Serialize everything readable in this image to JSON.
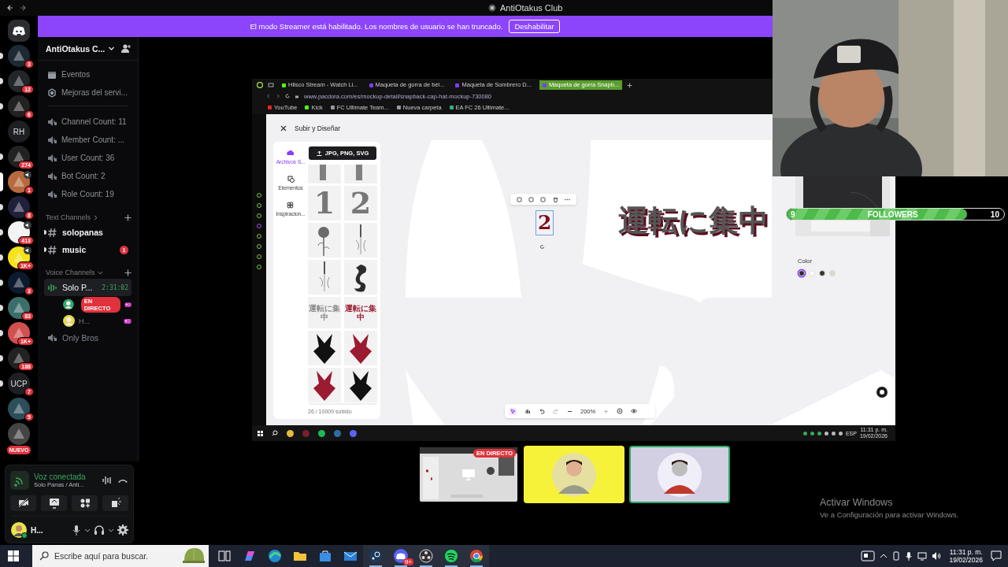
{
  "title_bar": {
    "title": "AntiOtakus Club"
  },
  "streamer_banner": {
    "message": "El modo Streamer está habilitado. Los nombres de usuario se han truncado.",
    "button": "Deshabilitar"
  },
  "servers": [
    {
      "kind": "home",
      "unread": false,
      "selected": false,
      "voice": false
    },
    {
      "kind": "icon",
      "badge": "3",
      "unread": true,
      "selected": false,
      "voice": false
    },
    {
      "kind": "icon",
      "badge": "12",
      "unread": true,
      "selected": false,
      "voice": false
    },
    {
      "kind": "icon",
      "badge": "6",
      "unread": true,
      "selected": false,
      "voice": false
    },
    {
      "kind": "text",
      "label": "RH",
      "unread": false,
      "selected": false,
      "voice": false
    },
    {
      "kind": "icon",
      "badge": "274",
      "unread": true,
      "selected": false,
      "voice": false
    },
    {
      "kind": "icon",
      "badge": "1",
      "unread": false,
      "selected": true,
      "voice": true
    },
    {
      "kind": "icon",
      "badge": "8",
      "unread": true,
      "selected": false,
      "voice": false
    },
    {
      "kind": "icon",
      "badge": "413",
      "unread": true,
      "selected": false,
      "voice": true
    },
    {
      "kind": "icon",
      "badge": "1K+",
      "unread": true,
      "selected": false,
      "voice": true
    },
    {
      "kind": "icon",
      "badge": "3",
      "unread": true,
      "selected": false,
      "voice": false
    },
    {
      "kind": "icon",
      "badge": "83",
      "unread": true,
      "selected": false,
      "voice": false
    },
    {
      "kind": "icon",
      "badge": "1K+",
      "unread": true,
      "selected": false,
      "voice": false
    },
    {
      "kind": "icon",
      "badge": "188",
      "unread": true,
      "selected": false,
      "voice": false
    },
    {
      "kind": "text",
      "label": "UCP",
      "badge": "7",
      "unread": true,
      "selected": false,
      "voice": false
    },
    {
      "kind": "icon",
      "badge": "5",
      "unread": false,
      "selected": false,
      "voice": false
    },
    {
      "kind": "icon",
      "pill": "NUEVO",
      "unread": false,
      "selected": false,
      "voice": false
    }
  ],
  "server_header": {
    "name": "AntiOtakus C..."
  },
  "sidebar": {
    "items": [
      {
        "kind": "events",
        "label": "Eventos"
      },
      {
        "kind": "boosts",
        "label": "Mejoras del servi..."
      }
    ],
    "stat_channels": [
      {
        "label": "Channel Count: 11"
      },
      {
        "label": "Member Count: ..."
      },
      {
        "label": "User Count: 36"
      },
      {
        "label": "Bot Count: 2"
      },
      {
        "label": "Role Count: 19"
      }
    ],
    "categories": [
      {
        "name": "Text Channels",
        "expanded": false,
        "channels": [
          {
            "kind": "text",
            "name": "solopanas",
            "unread": true,
            "selected": false
          },
          {
            "kind": "text",
            "name": "music",
            "unread": true,
            "selected": false,
            "badge": "1"
          }
        ]
      },
      {
        "name": "Voice Channels",
        "expanded": true,
        "channels": [
          {
            "kind": "voice",
            "name": "Solo P...",
            "unread": true,
            "selected": true,
            "time": "2:31:02",
            "users": [
              {
                "badge": "EN DIRECTO",
                "activity": true
              },
              {
                "name": "H...",
                "activity": true
              }
            ]
          },
          {
            "kind": "voice",
            "name": "Only Bros",
            "unread": false,
            "selected": false
          }
        ]
      }
    ]
  },
  "voice_panel": {
    "status": "Voz conectada",
    "channel": "Solo Panas / Anti...",
    "user": {
      "name": "H..."
    }
  },
  "stream": {
    "browser": {
      "tabs": [
        {
          "title": "Hilsco Stream - Watch Li...",
          "selected": false
        },
        {
          "title": "Maqueta de gorra de béi...",
          "selected": false
        },
        {
          "title": "Maqueta de Sombrero D...",
          "selected": false
        },
        {
          "title": "Maqueta de gorra Snapb...",
          "selected": true
        }
      ],
      "url": "www.pacdora.com/es/mockup-detail/snapback-cap-hat-mockup-730080",
      "bookmarks": [
        "YouTube",
        "Kick",
        "FC Ultimate Team...",
        "Nueva carpeta",
        "EA FC 26 Ultimate..."
      ]
    },
    "page": {
      "title": "Subir y Diseñar",
      "nav": [
        {
          "label": "Archivos S...",
          "selected": true
        },
        {
          "label": "Elementos",
          "selected": false
        },
        {
          "label": "Inspiracion...",
          "selected": false
        }
      ],
      "upload_button": "JPG, PNG, SVG",
      "assets": [
        {
          "kind": "partial"
        },
        {
          "kind": "partial"
        },
        {
          "kind": "glyph",
          "text": "1"
        },
        {
          "kind": "glyph",
          "text": "2"
        },
        {
          "kind": "rose"
        },
        {
          "kind": "sword"
        },
        {
          "kind": "sword"
        },
        {
          "kind": "dragon"
        },
        {
          "kind": "phrase",
          "text": "運転に集中",
          "color": "#8a8a8a"
        },
        {
          "kind": "phrase",
          "text": "運転に集中",
          "color": "#9b1b30"
        },
        {
          "kind": "tribal",
          "color": "#111111"
        },
        {
          "kind": "tribal",
          "color": "#9b1b30"
        },
        {
          "kind": "tribal",
          "color": "#9b1b30"
        },
        {
          "kind": "tribal",
          "color": "#111111"
        }
      ],
      "footer": "26 / 10000 subido",
      "selected_text": "2",
      "design_text": "運転に集中",
      "color_label": "Color",
      "swatches": [
        {
          "color": "#2b2b2b",
          "selected": true
        },
        {
          "color": "#ffffff",
          "selected": false
        },
        {
          "color": "#333333",
          "selected": false
        },
        {
          "color": "#d8d8cc",
          "selected": false
        }
      ],
      "zoom": "200%"
    },
    "taskbar": {
      "language": "ESP",
      "time": "11:31 p. m.",
      "date": "19/02/2026"
    }
  },
  "followers": {
    "start": "9",
    "label": "FOLLOWERS",
    "goal": "10",
    "level": 0.83
  },
  "participants": [
    {
      "kind": "stream",
      "badge": "EN DIRECTO",
      "selected": false
    },
    {
      "kind": "avatar",
      "color": "#f6f23a",
      "selected": false
    },
    {
      "kind": "avatar",
      "color": "#d3cfe2",
      "selected": true
    }
  ],
  "windows_notice": {
    "title": "Activar Windows",
    "subtitle": "Ve a Configuración para activar Windows."
  },
  "taskbar": {
    "search_placeholder": "Escribe aquí para buscar.",
    "apps": [
      {
        "kind": "taskview",
        "active": false
      },
      {
        "kind": "copilot",
        "active": false
      },
      {
        "kind": "edge",
        "active": false
      },
      {
        "kind": "explorer",
        "active": false
      },
      {
        "kind": "store",
        "active": false
      },
      {
        "kind": "mail",
        "active": false
      },
      {
        "kind": "steam",
        "active": true
      },
      {
        "kind": "discord",
        "active": true,
        "badge": "9+"
      },
      {
        "kind": "obs",
        "active": true
      },
      {
        "kind": "spotify",
        "active": true
      },
      {
        "kind": "chrome",
        "active": true
      }
    ],
    "time": "11:31 p. m.",
    "date": "19/02/2026"
  }
}
